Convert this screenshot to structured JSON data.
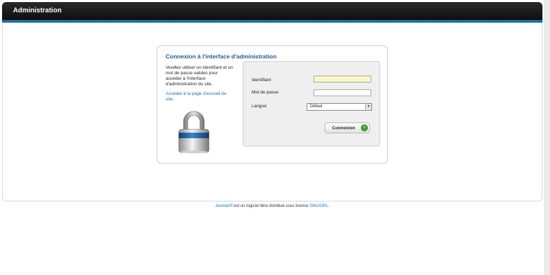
{
  "header": {
    "title": "Administration"
  },
  "login": {
    "title": "Connexion à l'interface d'administration",
    "description": "Veuillez utiliser un identifiant et un mot de passe valides pour accéder à l'interface d'administration du site.",
    "home_link": "Accéder à la page d'accueil du site.",
    "username_label": "Identifiant",
    "username_value": "",
    "password_label": "Mot de passe",
    "password_value": "",
    "language_label": "Langue",
    "language_selected": "Défaut",
    "submit_label": "Connexion",
    "submit_icon": "arrow-right-circle-icon",
    "lock_icon": "padlock-icon"
  },
  "footer": {
    "brand": "Joomla!®",
    "text": " est un logiciel libre distribué sous licence ",
    "license": "GNU/GPL",
    "end": "."
  },
  "colors": {
    "header_bg": "#111111",
    "accent_blue": "#1c6fa8",
    "title_blue": "#1b5e8a",
    "field_highlight": "#fbf7c9",
    "go_green": "#3da52f"
  }
}
